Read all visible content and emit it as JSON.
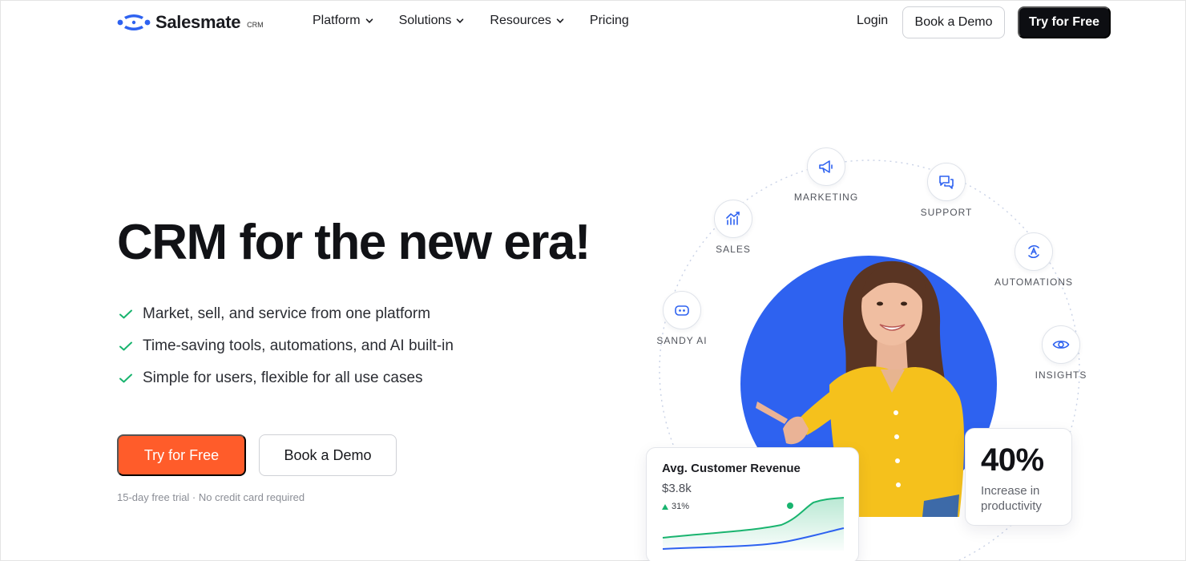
{
  "nav": {
    "brand": "Salesmate",
    "brand_suffix": "CRM",
    "menu": [
      {
        "label": "Platform",
        "has_dropdown": true
      },
      {
        "label": "Solutions",
        "has_dropdown": true
      },
      {
        "label": "Resources",
        "has_dropdown": true
      },
      {
        "label": "Pricing",
        "has_dropdown": false
      }
    ],
    "login": "Login",
    "book_demo": "Book a Demo",
    "try_free": "Try for Free"
  },
  "hero": {
    "title": "CRM for the new era!",
    "bullets": [
      "Market, sell, and service from one platform",
      "Time-saving tools, automations, and AI built-in",
      "Simple for users, flexible for all use cases"
    ],
    "cta_primary": "Try for Free",
    "cta_secondary": "Book a Demo",
    "note": "15-day free trial · No credit card required"
  },
  "features": [
    {
      "label": "SANDY AI",
      "icon": "robot-icon"
    },
    {
      "label": "SALES",
      "icon": "chart-up-icon"
    },
    {
      "label": "MARKETING",
      "icon": "megaphone-icon"
    },
    {
      "label": "SUPPORT",
      "icon": "chat-bubbles-icon"
    },
    {
      "label": "AUTOMATIONS",
      "icon": "automation-icon"
    },
    {
      "label": "INSIGHTS",
      "icon": "eye-icon"
    }
  ],
  "revenue_card": {
    "title": "Avg. Customer Revenue",
    "value": "$3.8k",
    "delta": "31%"
  },
  "productivity_card": {
    "value": "40%",
    "label": "Increase in productivity"
  },
  "colors": {
    "accent_orange": "#ff5c2a",
    "brand_blue": "#2e62f0",
    "dark": "#0d0e12",
    "success_green": "#19b46f"
  }
}
